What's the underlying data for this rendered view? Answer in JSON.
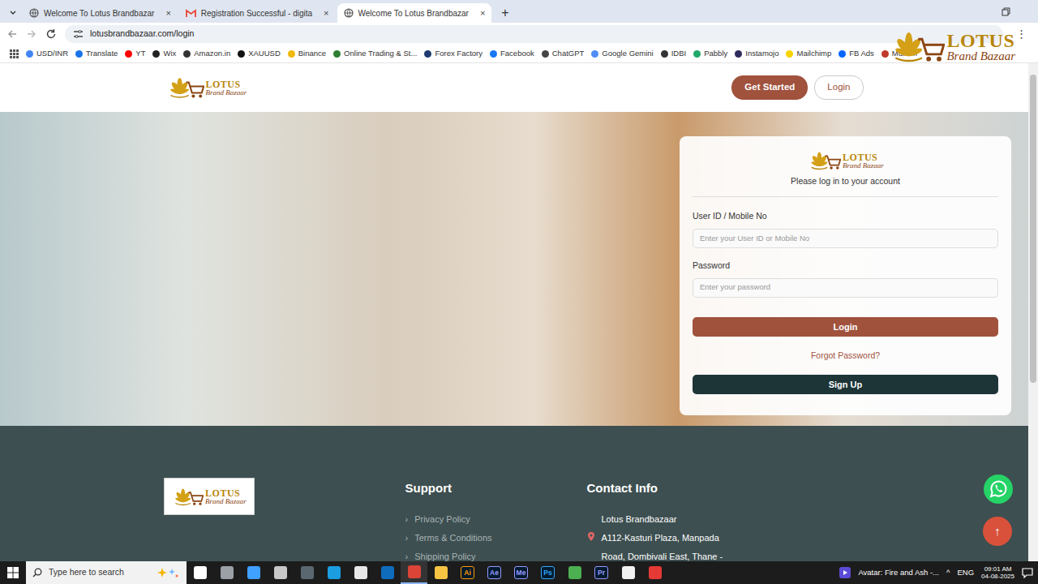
{
  "browser": {
    "tabs": [
      {
        "label": "Welcome To Lotus Brandbazar",
        "close": "×",
        "kind": "site",
        "selected": false
      },
      {
        "label": "Registration Successful - digita",
        "close": "×",
        "kind": "mail",
        "selected": false
      },
      {
        "label": "Welcome To Lotus Brandbazar",
        "close": "×",
        "kind": "site",
        "selected": true
      }
    ],
    "new_tab": "+",
    "url": "lotusbrandbazaar.com/login",
    "menu": "⋮",
    "bookmarks": [
      {
        "label": "USD/INR",
        "color": "#4285f4"
      },
      {
        "label": "Translate",
        "color": "#1a73e8"
      },
      {
        "label": "YT",
        "color": "#ff0000"
      },
      {
        "label": "Wix",
        "color": "#222222"
      },
      {
        "label": "Amazon.in",
        "color": "#333333"
      },
      {
        "label": "XAUUSD",
        "color": "#111111"
      },
      {
        "label": "Binance",
        "color": "#f0b90b"
      },
      {
        "label": "Online Trading & St...",
        "color": "#2e7d32"
      },
      {
        "label": "Forex Factory",
        "color": "#1f3b70"
      },
      {
        "label": "Facebook",
        "color": "#1877f2"
      },
      {
        "label": "ChatGPT",
        "color": "#444444"
      },
      {
        "label": "Google Gemini",
        "color": "#4f8df5"
      },
      {
        "label": "IDBI",
        "color": "#333333"
      },
      {
        "label": "Pabbly",
        "color": "#20a86b"
      },
      {
        "label": "Instamojo",
        "color": "#2d2a5c"
      },
      {
        "label": "Mailchimp",
        "color": "#f5d400"
      },
      {
        "label": "FB Ads",
        "color": "#0866ff"
      },
      {
        "label": "Mukam",
        "color": "#c0392b"
      }
    ]
  },
  "brand": {
    "name": "LOTUS",
    "word2": "Brand",
    "word3": "Bazaar"
  },
  "header": {
    "buttons": [
      "Get Started",
      "Login"
    ]
  },
  "login": {
    "heading": "Please log in to your account",
    "user_label": "User ID / Mobile No",
    "user_placeholder": "Enter your User ID or Mobile No",
    "password_label": "Password",
    "password_placeholder": "Enter your password",
    "login_button": "Login",
    "forgot": "Forgot Password?",
    "signup": "Sign Up"
  },
  "footer": {
    "support_title": "Support",
    "bullet": "›",
    "support_links": [
      "Privacy Policy",
      "Terms & Conditions",
      "Shipping Policy"
    ],
    "contact_title": "Contact Info",
    "contact_lines": [
      "Lotus Brandbazaar",
      "A112-Kasturi Plaza, Manpada",
      "Road, Dombivali East, Thane -"
    ]
  },
  "scroll_top": "↑",
  "taskbar": {
    "search_placeholder": "Type here to search",
    "apps": [
      {
        "kind": "shape",
        "color": "#ffffff",
        "selected": false
      },
      {
        "kind": "shape",
        "color": "#9aa0a6",
        "selected": false
      },
      {
        "kind": "shape",
        "color": "#3fa0ff",
        "selected": false
      },
      {
        "kind": "shape",
        "color": "#c8c8c8",
        "selected": false
      },
      {
        "kind": "shape",
        "color": "#5b6770",
        "selected": false
      },
      {
        "kind": "shape",
        "color": "#1b9de2",
        "selected": false
      },
      {
        "kind": "shape",
        "color": "#e8e8e8",
        "selected": false
      },
      {
        "kind": "shape",
        "color": "#0f6cbd",
        "selected": false
      },
      {
        "kind": "shape",
        "color": "#db4437",
        "selected": true
      },
      {
        "kind": "shape",
        "color": "#f6c343",
        "selected": false
      },
      {
        "kind": "badge",
        "label": "Ai",
        "color": "#ff9a00",
        "selected": false
      },
      {
        "kind": "badge",
        "label": "Ae",
        "color": "#9999ff",
        "selected": false
      },
      {
        "kind": "badge",
        "label": "Me",
        "color": "#9999ff",
        "selected": false
      },
      {
        "kind": "badge",
        "label": "Ps",
        "color": "#31a8ff",
        "selected": false
      },
      {
        "kind": "shape",
        "color": "#4caf50",
        "selected": false
      },
      {
        "kind": "badge",
        "label": "Pr",
        "color": "#9999ff",
        "selected": false
      },
      {
        "kind": "shape",
        "color": "#f2f2f2",
        "selected": false
      },
      {
        "kind": "shape",
        "color": "#e53935",
        "selected": false
      }
    ],
    "media": "Avatar: Fire and Ash -...",
    "tray": "^",
    "language": "ENG",
    "time": "09:01 AM",
    "date": "04-08-2025"
  }
}
